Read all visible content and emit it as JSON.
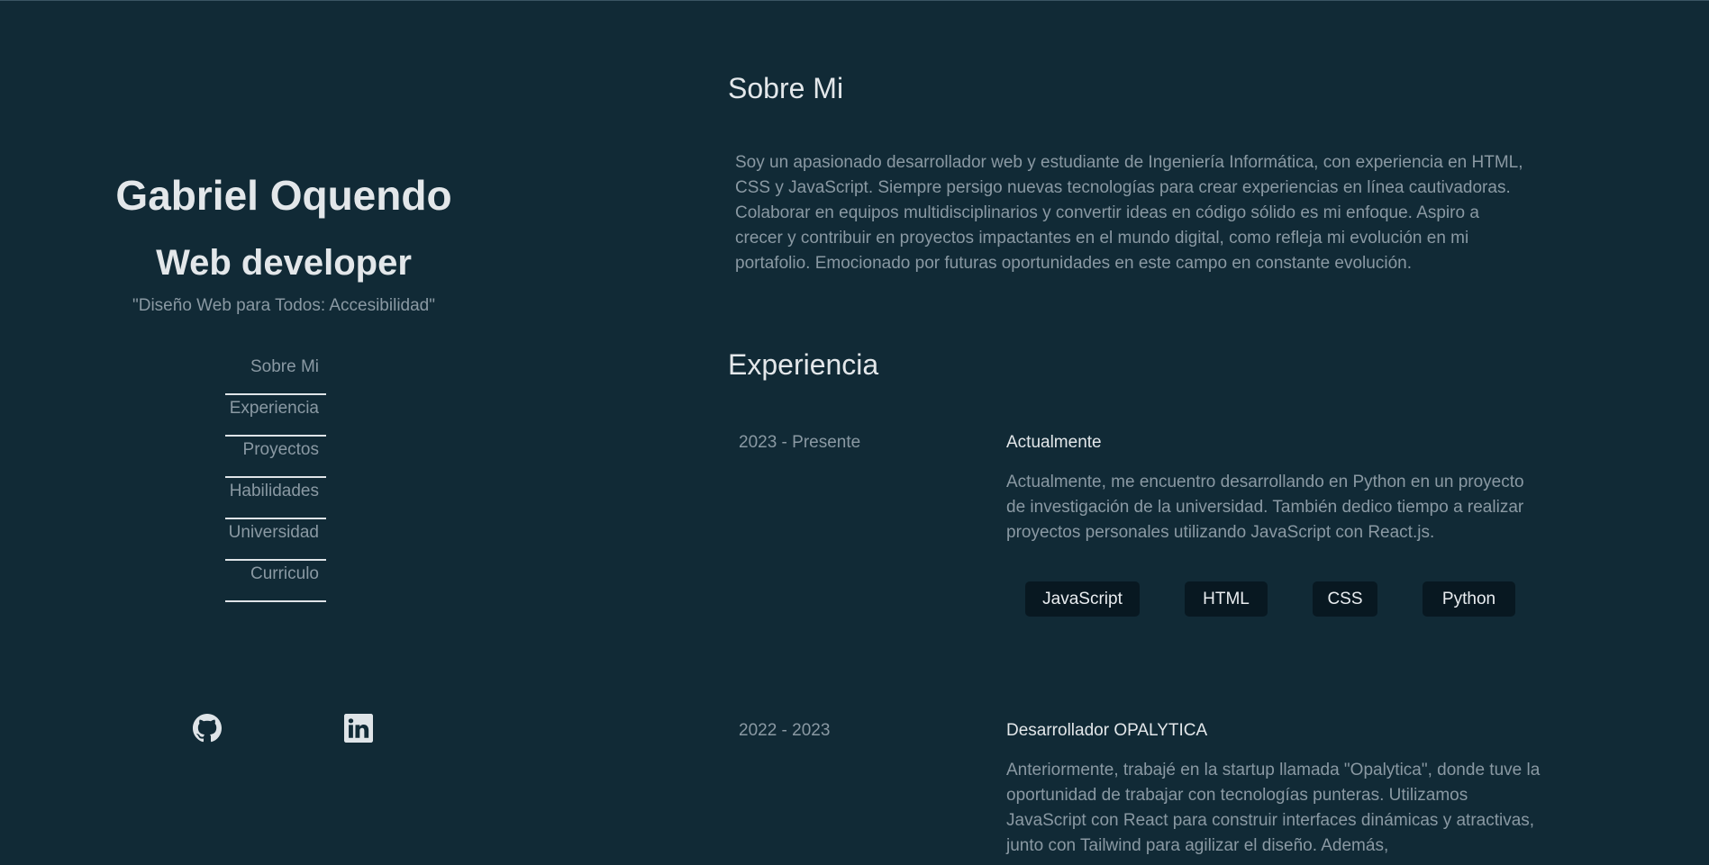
{
  "profile": {
    "name": "Gabriel Oquendo",
    "role": "Web developer",
    "tagline": "\"Diseño Web para Todos: Accesibilidad\""
  },
  "nav": {
    "items": [
      {
        "label": "Sobre Mi"
      },
      {
        "label": "Experiencia"
      },
      {
        "label": "Proyectos"
      },
      {
        "label": "Habilidades"
      },
      {
        "label": "Universidad"
      },
      {
        "label": "Curriculo"
      }
    ]
  },
  "social": {
    "github_icon": "github-icon",
    "linkedin_icon": "linkedin-icon"
  },
  "about": {
    "title": "Sobre Mi",
    "text": "Soy un apasionado desarrollador web y estudiante de Ingeniería Informática, con experiencia en HTML, CSS y JavaScript. Siempre persigo nuevas tecnologías para crear experiencias en línea cautivadoras. Colaborar en equipos multidisciplinarios y convertir ideas en código sólido es mi enfoque. Aspiro a crecer y contribuir en proyectos impactantes en el mundo digital, como refleja mi evolución en mi portafolio. Emocionado por futuras oportunidades en este campo en constante evolución."
  },
  "experience": {
    "title": "Experiencia",
    "items": [
      {
        "period": "2023 - Presente",
        "title": "Actualmente",
        "description": "Actualmente, me encuentro desarrollando en Python en un proyecto de investigación de la universidad. También dedico tiempo a realizar proyectos personales utilizando JavaScript con React.js.",
        "tags": [
          "JavaScript",
          "HTML",
          "CSS",
          "Python"
        ]
      },
      {
        "period": "2022 - 2023",
        "title": "Desarrollador OPALYTICA",
        "description": "Anteriormente, trabajé en la startup llamada \"Opalytica\", donde tuve la oportunidad de trabajar con tecnologías punteras. Utilizamos JavaScript con React para construir interfaces dinámicas y atractivas, junto con Tailwind para agilizar el diseño. Además,"
      }
    ]
  },
  "colors": {
    "background": "#112a36",
    "heading": "#e3e7ea",
    "muted": "#8a99a3",
    "tag_bg": "#081821"
  }
}
